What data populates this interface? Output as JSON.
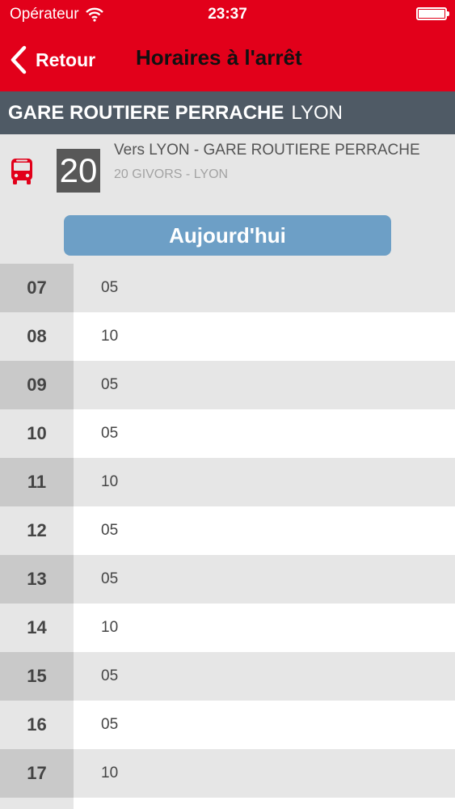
{
  "status_bar": {
    "carrier": "Opérateur",
    "time": "23:37"
  },
  "nav": {
    "back_label": "Retour",
    "title": "Horaires à l'arrêt"
  },
  "stop": {
    "name": "GARE ROUTIERE PERRACHE",
    "city": "LYON"
  },
  "line": {
    "number": "20",
    "direction": "Vers LYON - GARE ROUTIERE PERRACHE",
    "route": "20 GIVORS - LYON"
  },
  "day_button": "Aujourd'hui",
  "schedule": [
    {
      "hour": "07",
      "minutes": "05"
    },
    {
      "hour": "08",
      "minutes": "10"
    },
    {
      "hour": "09",
      "minutes": "05"
    },
    {
      "hour": "10",
      "minutes": "05"
    },
    {
      "hour": "11",
      "minutes": "10"
    },
    {
      "hour": "12",
      "minutes": "05"
    },
    {
      "hour": "13",
      "minutes": "05"
    },
    {
      "hour": "14",
      "minutes": "10"
    },
    {
      "hour": "15",
      "minutes": "05"
    },
    {
      "hour": "16",
      "minutes": "05"
    },
    {
      "hour": "17",
      "minutes": "10"
    },
    {
      "hour": "",
      "minutes": ""
    }
  ],
  "colors": {
    "header_red": "#e2001a",
    "stop_bar": "#4f5a65",
    "day_button": "#6d9fc6",
    "line_badge": "#585858"
  },
  "icons": {
    "wifi": "wifi-icon",
    "battery": "battery-icon",
    "back": "chevron-left-icon",
    "bus": "bus-icon"
  }
}
